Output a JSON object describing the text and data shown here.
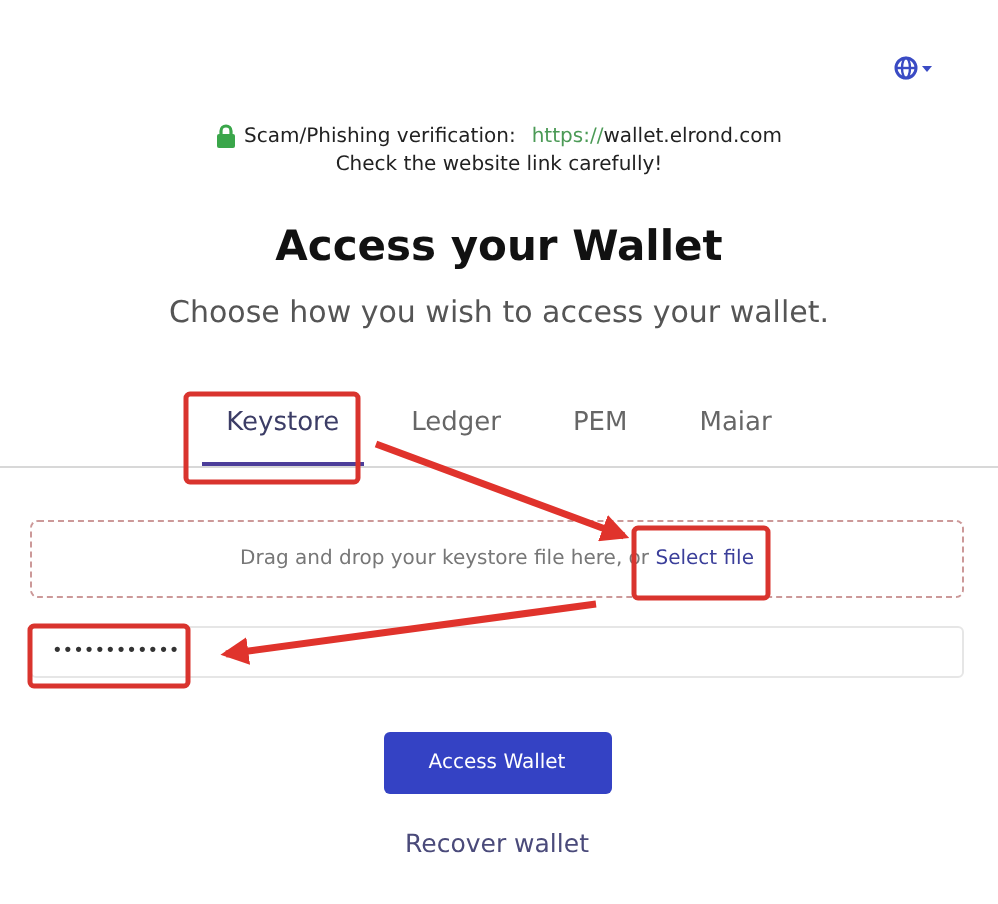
{
  "notice": {
    "label": "Scam/Phishing verification:",
    "url_scheme": "https://",
    "url_host": "wallet.elrond.com",
    "warning": "Check the website link carefully!"
  },
  "title": "Access your Wallet",
  "subtitle": "Choose how you wish to access your wallet.",
  "tabs": [
    {
      "label": "Keystore",
      "selected": true
    },
    {
      "label": "Ledger",
      "selected": false
    },
    {
      "label": "PEM",
      "selected": false
    },
    {
      "label": "Maiar",
      "selected": false
    }
  ],
  "dropzone": {
    "text": "Drag and drop your keystore file here, or",
    "link": "Select file"
  },
  "password": {
    "value": "••••••••••••"
  },
  "primary_button": "Access Wallet",
  "secondary_link": "Recover wallet"
}
